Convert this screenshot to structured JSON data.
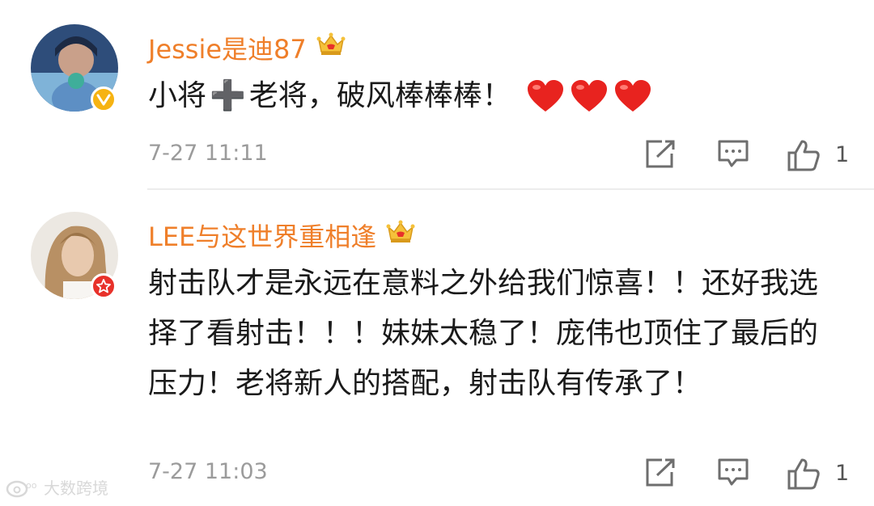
{
  "comments": [
    {
      "username": "Jessie是迪87",
      "text_main": "小将",
      "text_plus": "➕",
      "text_rest": "老将，破风棒棒棒！",
      "timestamp": "7-27 11:11",
      "like_count": "1",
      "badge": "verified-v"
    },
    {
      "username": "LEE与这世界重相逢",
      "text": "射击队才是永远在意料之外给我们惊喜！！还好我选择了看射击！！！妹妹太稳了！庞伟也顶住了最后的压力！老将新人的搭配，射击队有传承了！",
      "timestamp": "7-27 11:03",
      "like_count": "1",
      "badge": "star"
    }
  ],
  "watermark": {
    "text": "大数跨境"
  },
  "colors": {
    "username": "#ef7f2a",
    "text": "#1a1a1a",
    "meta": "#9b9b9b",
    "heart": "#e8231f"
  }
}
